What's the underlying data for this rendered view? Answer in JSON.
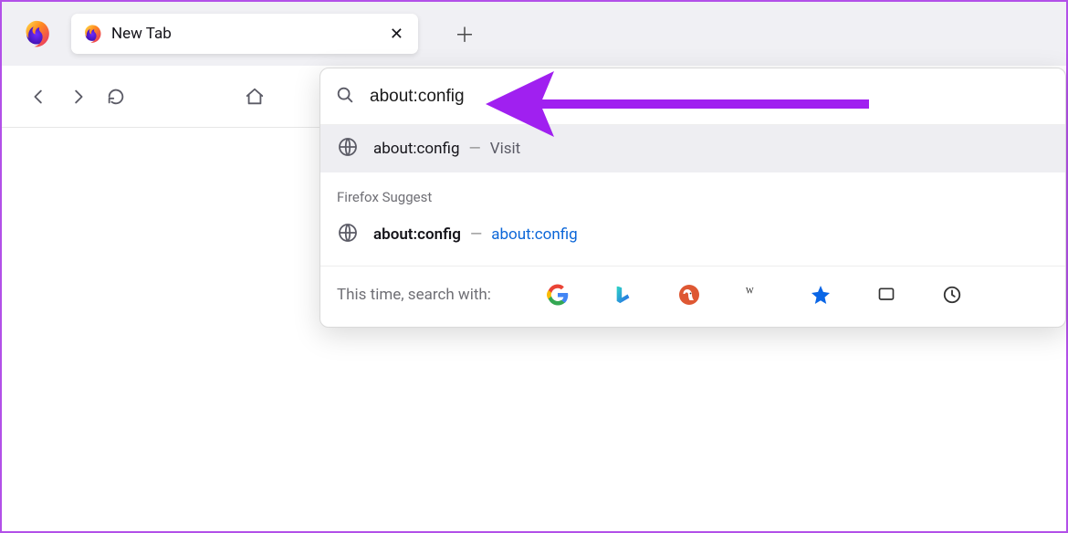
{
  "tab": {
    "title": "New Tab"
  },
  "url": {
    "value": "about:config"
  },
  "suggestions": {
    "row1": {
      "main": "about:config",
      "secondary": "Visit"
    },
    "header": "Firefox Suggest",
    "row2": {
      "main": "about:config",
      "secondary": "about:config"
    }
  },
  "engines": {
    "label": "This time, search with:"
  }
}
